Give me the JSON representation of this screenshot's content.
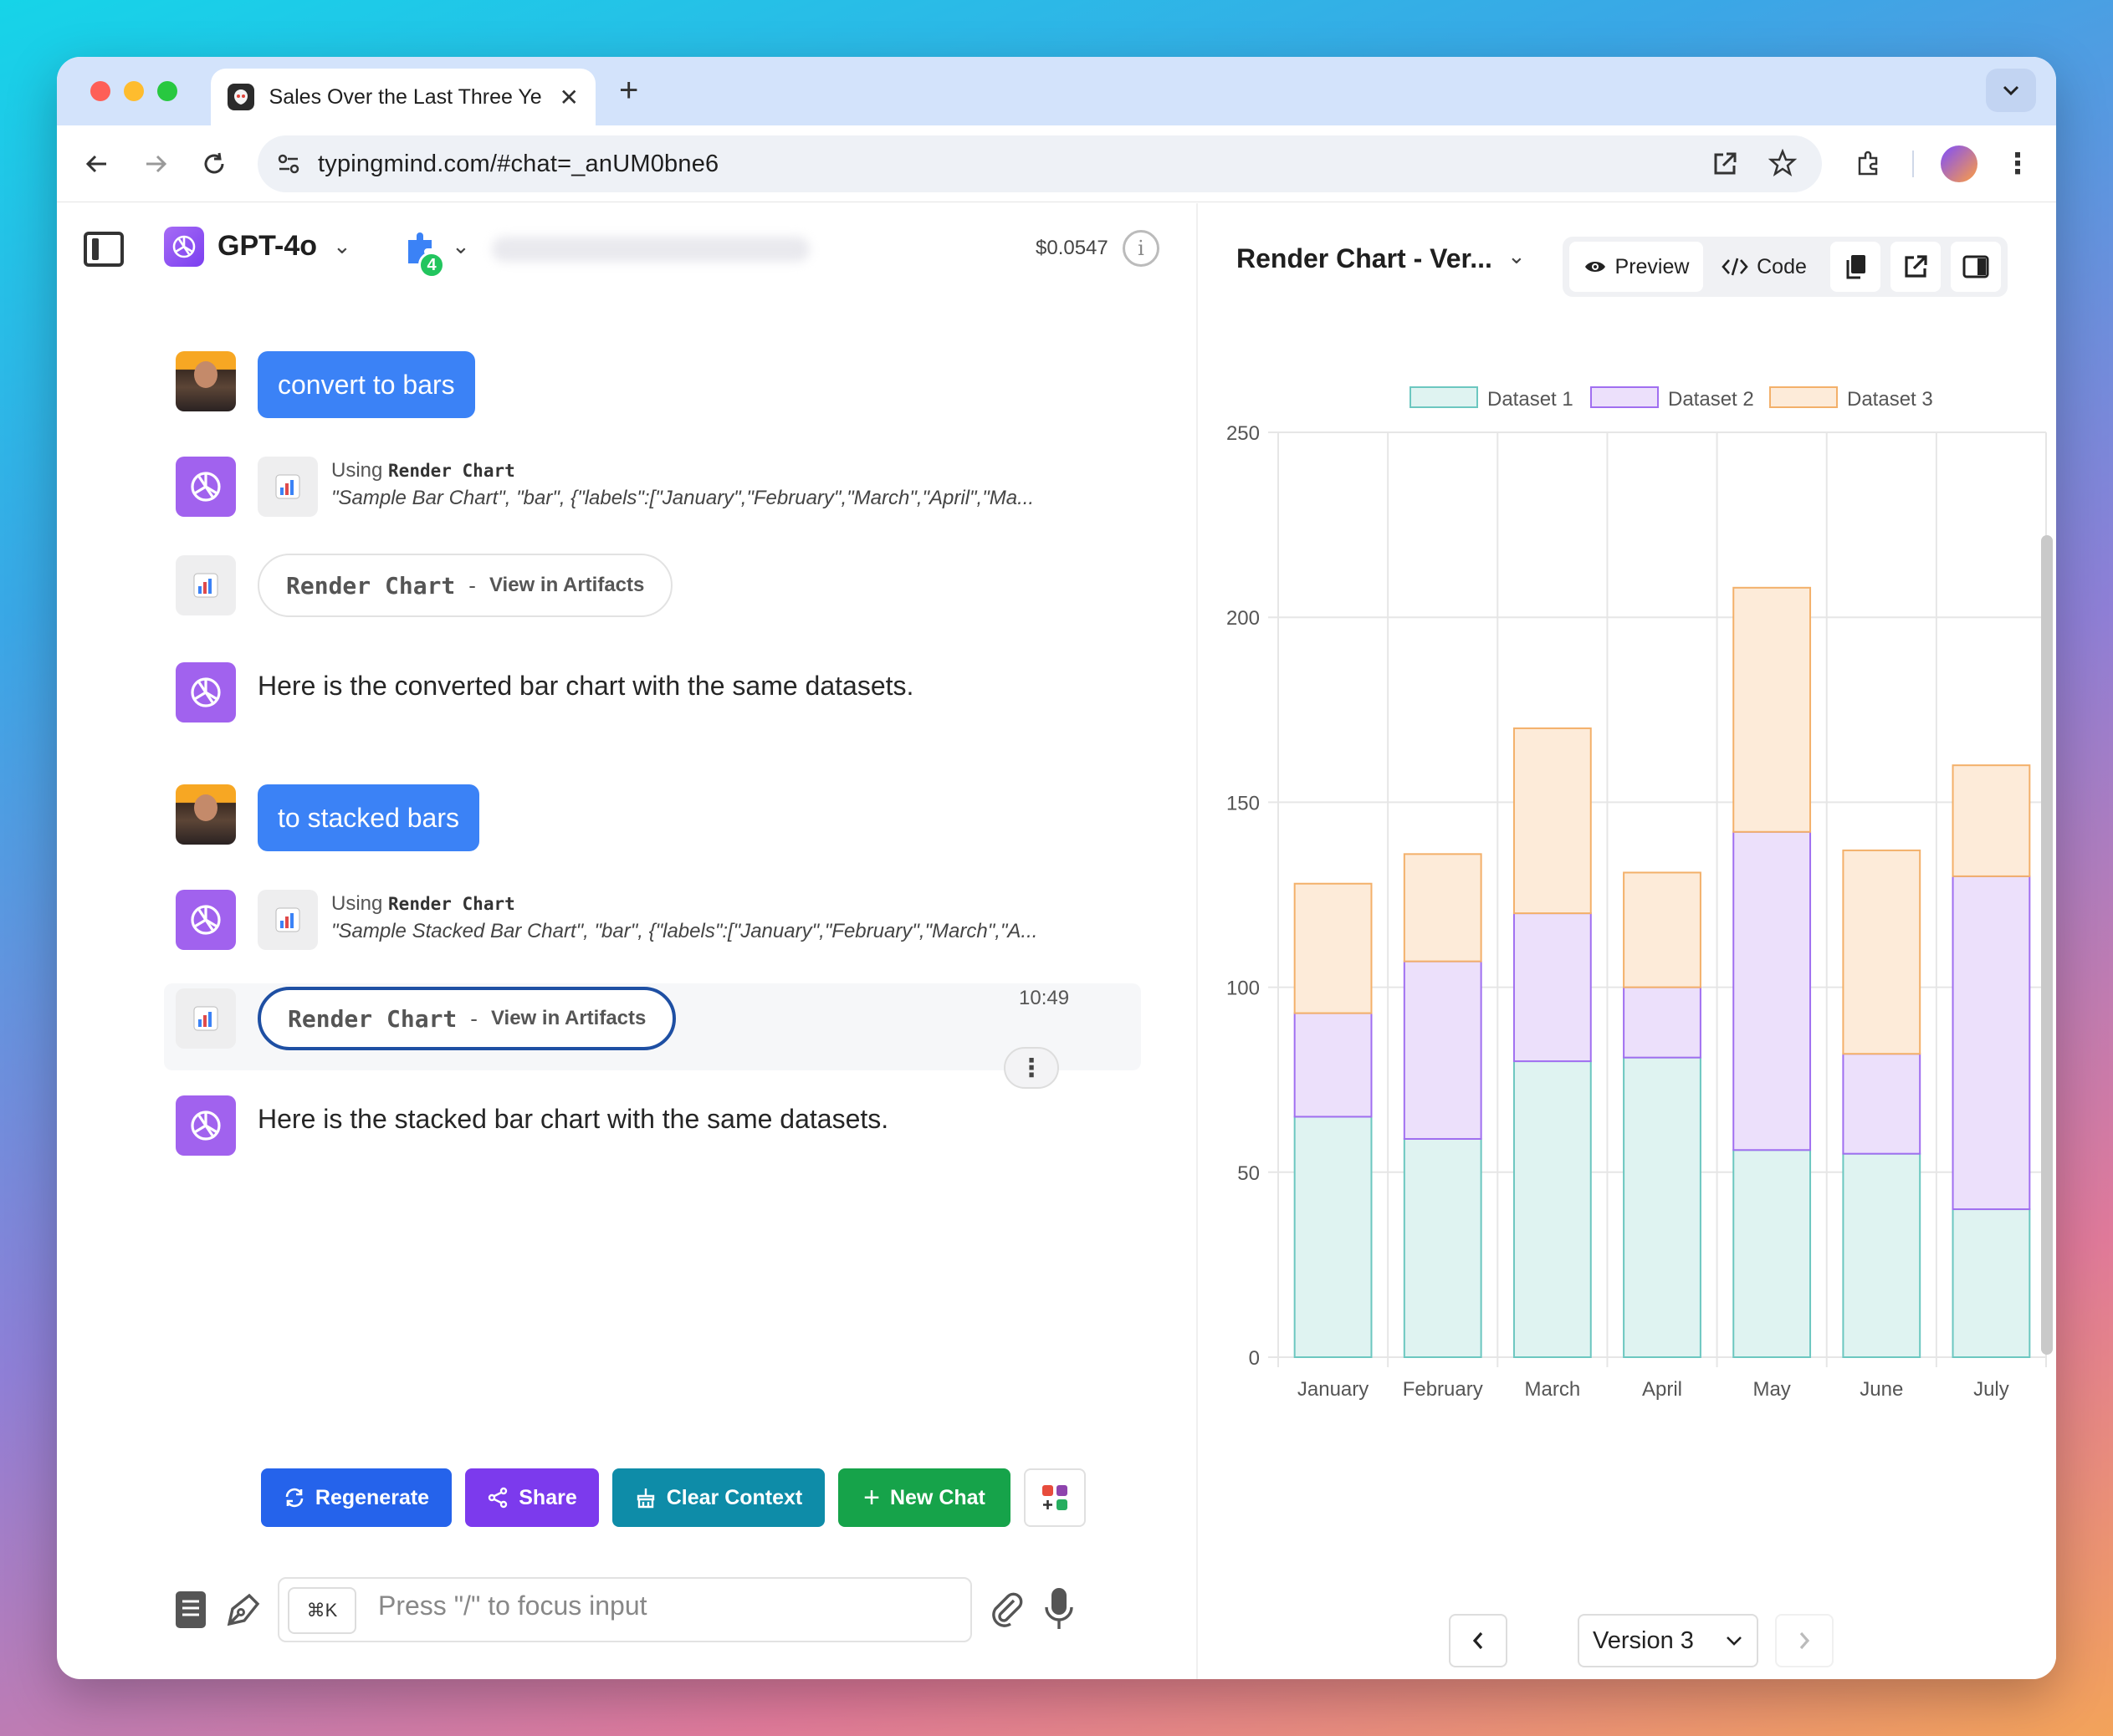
{
  "browser": {
    "tab_title": "Sales Over the Last Three Ye",
    "url": "typingmind.com/#chat=_anUM0bne6"
  },
  "chat_header": {
    "model_name": "GPT-4o",
    "plugin_count": "4",
    "cost": "$0.0547",
    "info_label": "i"
  },
  "messages": {
    "user1": "convert to bars",
    "using1_prefix": "Using",
    "using1_tool": "Render Chart",
    "using1_args": "\"Sample Bar Chart\", \"bar\", {\"labels\":[\"January\",\"February\",\"March\",\"April\",\"Ma...",
    "render1_tool": "Render Chart",
    "render1_sep": "-",
    "render1_link": "View in Artifacts",
    "ai1": "Here is the converted bar chart with the same datasets.",
    "user2": "to stacked bars",
    "using2_prefix": "Using",
    "using2_tool": "Render Chart",
    "using2_args": "\"Sample Stacked Bar Chart\", \"bar\", {\"labels\":[\"January\",\"February\",\"March\",\"A...",
    "render2_tool": "Render Chart",
    "render2_sep": "-",
    "render2_link": "View in Artifacts",
    "timestamp": "10:49",
    "ai2": "Here is the stacked bar chart with the same datasets."
  },
  "actions": {
    "regenerate": "Regenerate",
    "share": "Share",
    "clear_context": "Clear Context",
    "new_chat": "New Chat"
  },
  "input": {
    "shortcut": "⌘K",
    "placeholder": "Press \"/\" to focus input"
  },
  "artifact": {
    "title": "Render Chart - Ver...",
    "preview": "Preview",
    "code": "Code",
    "version": "Version 3"
  },
  "colors": {
    "user_bubble": "#3b82f6",
    "gpt_avatar": "#a162ee",
    "dataset1_fill": "#dff3f1",
    "dataset1_stroke": "#6cc7c0",
    "dataset2_fill": "#ece0fb",
    "dataset2_stroke": "#a06ff0",
    "dataset3_fill": "#fdebd9",
    "dataset3_stroke": "#f3b06a"
  },
  "chart_data": {
    "type": "bar",
    "stacked": true,
    "categories": [
      "January",
      "February",
      "March",
      "April",
      "May",
      "June",
      "July"
    ],
    "series": [
      {
        "name": "Dataset 1",
        "values": [
          65,
          59,
          80,
          81,
          56,
          55,
          40
        ]
      },
      {
        "name": "Dataset 2",
        "values": [
          28,
          48,
          40,
          19,
          86,
          27,
          90
        ]
      },
      {
        "name": "Dataset 3",
        "values": [
          35,
          29,
          50,
          31,
          66,
          55,
          30
        ]
      }
    ],
    "ylim": [
      0,
      250
    ],
    "yticks": [
      "0",
      "50",
      "100",
      "150",
      "200",
      "250"
    ],
    "grid": true,
    "legend": "top"
  }
}
